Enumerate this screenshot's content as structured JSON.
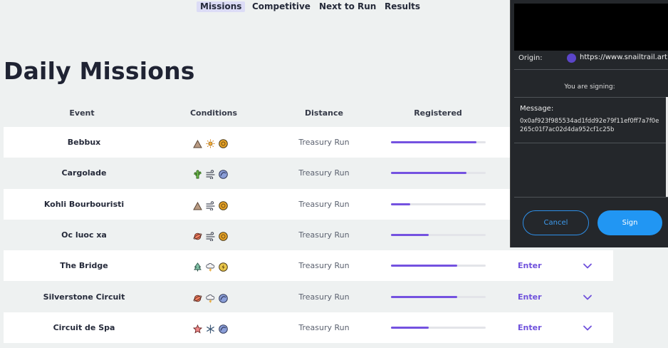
{
  "nav": {
    "tabs": [
      {
        "label": "Missions",
        "active": true
      },
      {
        "label": "Competitive",
        "active": false
      },
      {
        "label": "Next to Run",
        "active": false
      },
      {
        "label": "Results",
        "active": false
      }
    ]
  },
  "page": {
    "title": "Daily Missions"
  },
  "table": {
    "headers": {
      "event": "Event",
      "conditions": "Conditions",
      "distance": "Distance",
      "registered": "Registered"
    },
    "rows": [
      {
        "event": "Bebbux",
        "conditions": [
          "mountain-icon",
          "sun-icon",
          "coin-icon"
        ],
        "distance": "Treasury Run",
        "registered_fraction": 0.9,
        "enter": ""
      },
      {
        "event": "Cargolade",
        "conditions": [
          "cactus-icon",
          "wind-icon",
          "wave-icon"
        ],
        "distance": "Treasury Run",
        "registered_fraction": 0.8,
        "enter": ""
      },
      {
        "event": "Kohli Bourbouristi",
        "conditions": [
          "mountain-icon",
          "wind-icon",
          "coin-icon"
        ],
        "distance": "Treasury Run",
        "registered_fraction": 0.2,
        "enter": ""
      },
      {
        "event": "Oc luoc xa",
        "conditions": [
          "planet-icon",
          "wind-icon",
          "coin-icon"
        ],
        "distance": "Treasury Run",
        "registered_fraction": 0.4,
        "enter": ""
      },
      {
        "event": "The Bridge",
        "conditions": [
          "tree-icon",
          "storm-icon",
          "bolt-icon"
        ],
        "distance": "Treasury Run",
        "registered_fraction": 0.7,
        "enter": "Enter"
      },
      {
        "event": "Silverstone Circuit",
        "conditions": [
          "planet-icon",
          "storm-icon",
          "wave-icon"
        ],
        "distance": "Treasury Run",
        "registered_fraction": 0.7,
        "enter": "Enter"
      },
      {
        "event": "Circuit de Spa",
        "conditions": [
          "star-icon",
          "snowflake-icon",
          "wave-icon"
        ],
        "distance": "Treasury Run",
        "registered_fraction": 0.4,
        "enter": "Enter"
      }
    ]
  },
  "wallet": {
    "origin_label": "Origin:",
    "origin_url": "https://www.snailtrail.art",
    "signing_text": "You are signing:",
    "message_label": "Message:",
    "message": "0x0af923f985534ad1fdd92e79f11ef0ff7a7f0e265c01f7ac02d4da952cf1c25b",
    "cancel_label": "Cancel",
    "sign_label": "Sign"
  },
  "colors": {
    "accent": "#7452e0",
    "sign_button": "#2196f3",
    "wallet_bg": "#24272b"
  }
}
